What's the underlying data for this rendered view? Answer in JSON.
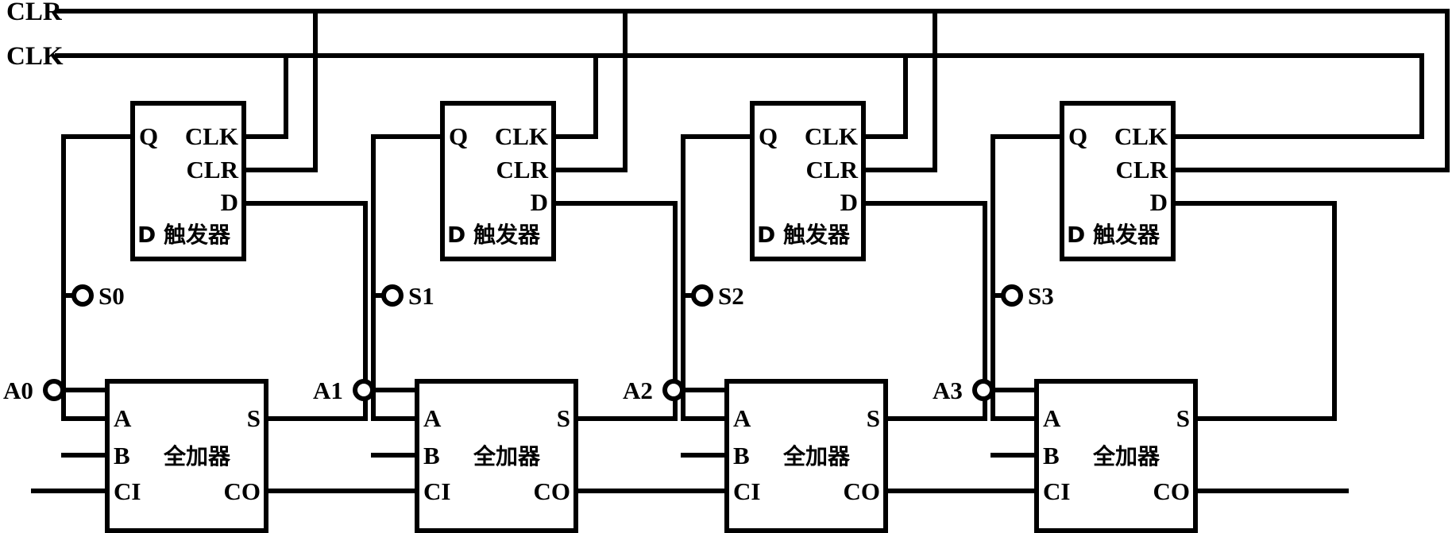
{
  "diagram": {
    "title": "4-bit accumulator / ripple-carry adder with D flip-flop register",
    "stage_count": 4,
    "stroke_color": "#000000",
    "background_color": "#ffffff"
  },
  "buses": [
    {
      "name": "clr-bus",
      "label": "CLR",
      "y": 14
    },
    {
      "name": "clk-bus",
      "label": "CLK",
      "y": 70
    }
  ],
  "flipflops": [
    {
      "name": "d-flipflop-0",
      "body_label": "D 触发器",
      "left_pins": [
        {
          "name": "q",
          "label": "Q"
        }
      ],
      "right_pins": [
        {
          "name": "clk",
          "label": "CLK"
        },
        {
          "name": "clr",
          "label": "CLR"
        },
        {
          "name": "d",
          "label": "D"
        }
      ]
    },
    {
      "name": "d-flipflop-1",
      "body_label": "D 触发器",
      "left_pins": [
        {
          "name": "q",
          "label": "Q"
        }
      ],
      "right_pins": [
        {
          "name": "clk",
          "label": "CLK"
        },
        {
          "name": "clr",
          "label": "CLR"
        },
        {
          "name": "d",
          "label": "D"
        }
      ]
    },
    {
      "name": "d-flipflop-2",
      "body_label": "D 触发器",
      "left_pins": [
        {
          "name": "q",
          "label": "Q"
        }
      ],
      "right_pins": [
        {
          "name": "clk",
          "label": "CLK"
        },
        {
          "name": "clr",
          "label": "CLR"
        },
        {
          "name": "d",
          "label": "D"
        }
      ]
    },
    {
      "name": "d-flipflop-3",
      "body_label": "D 触发器",
      "left_pins": [
        {
          "name": "q",
          "label": "Q"
        }
      ],
      "right_pins": [
        {
          "name": "clk",
          "label": "CLK"
        },
        {
          "name": "clr",
          "label": "CLR"
        },
        {
          "name": "d",
          "label": "D"
        }
      ]
    }
  ],
  "adders": [
    {
      "name": "full-adder-0",
      "body_label": "全加器",
      "left_pins": [
        {
          "name": "a",
          "label": "A"
        },
        {
          "name": "b",
          "label": "B"
        },
        {
          "name": "ci",
          "label": "CI"
        }
      ],
      "right_pins": [
        {
          "name": "s",
          "label": "S"
        },
        {
          "name": "co",
          "label": "CO"
        }
      ]
    },
    {
      "name": "full-adder-1",
      "body_label": "全加器",
      "left_pins": [
        {
          "name": "a",
          "label": "A"
        },
        {
          "name": "b",
          "label": "B"
        },
        {
          "name": "ci",
          "label": "CI"
        }
      ],
      "right_pins": [
        {
          "name": "s",
          "label": "S"
        },
        {
          "name": "co",
          "label": "CO"
        }
      ]
    },
    {
      "name": "full-adder-2",
      "body_label": "全加器",
      "left_pins": [
        {
          "name": "a",
          "label": "A"
        },
        {
          "name": "b",
          "label": "B"
        },
        {
          "name": "ci",
          "label": "CI"
        }
      ],
      "right_pins": [
        {
          "name": "s",
          "label": "S"
        },
        {
          "name": "co",
          "label": "CO"
        }
      ]
    },
    {
      "name": "full-adder-3",
      "body_label": "全加器",
      "left_pins": [
        {
          "name": "a",
          "label": "A"
        },
        {
          "name": "b",
          "label": "B"
        },
        {
          "name": "ci",
          "label": "CI"
        }
      ],
      "right_pins": [
        {
          "name": "s",
          "label": "S"
        },
        {
          "name": "co",
          "label": "CO"
        }
      ]
    }
  ],
  "outputs": [
    {
      "name": "output-s0",
      "label": "S0"
    },
    {
      "name": "output-s1",
      "label": "S1"
    },
    {
      "name": "output-s2",
      "label": "S2"
    },
    {
      "name": "output-s3",
      "label": "S3"
    }
  ],
  "inputs": [
    {
      "name": "input-a0",
      "label": "A0"
    },
    {
      "name": "input-a1",
      "label": "A1"
    },
    {
      "name": "input-a2",
      "label": "A2"
    },
    {
      "name": "input-a3",
      "label": "A3"
    }
  ]
}
